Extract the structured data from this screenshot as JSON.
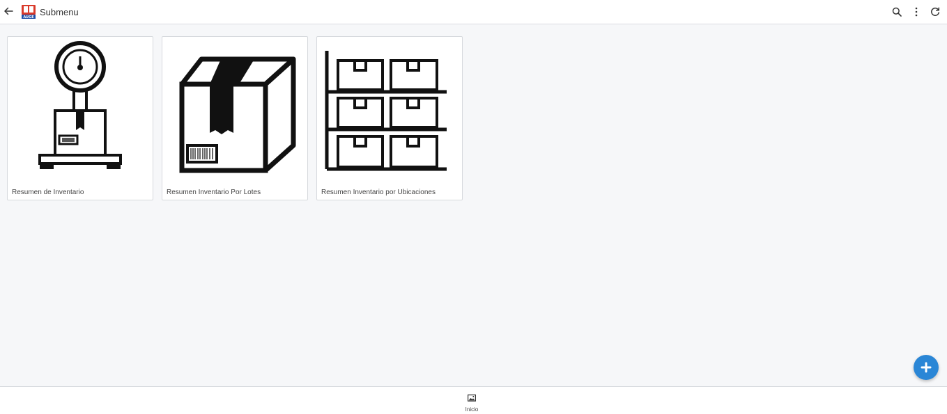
{
  "header": {
    "title": "Submenu",
    "logo_text": "AUGE",
    "back_icon": "arrow-left-icon",
    "actions": [
      "search-icon",
      "more-vert-icon",
      "refresh-icon"
    ]
  },
  "cards": [
    {
      "label": "Resumen de Inventario",
      "icon": "scale-icon"
    },
    {
      "label": "Resumen Inventario Por Lotes",
      "icon": "box-icon"
    },
    {
      "label": "Resumen Inventario por Ubicaciones",
      "icon": "shelves-icon"
    }
  ],
  "fab": {
    "icon": "plus-icon",
    "color": "#2a86d6"
  },
  "bottom_nav": {
    "items": [
      {
        "label": "Inicio",
        "icon": "image-icon"
      }
    ]
  },
  "colors": {
    "background": "#f6f7f9",
    "logo_red": "#d93a2b",
    "logo_blue": "#1f4fa8"
  }
}
